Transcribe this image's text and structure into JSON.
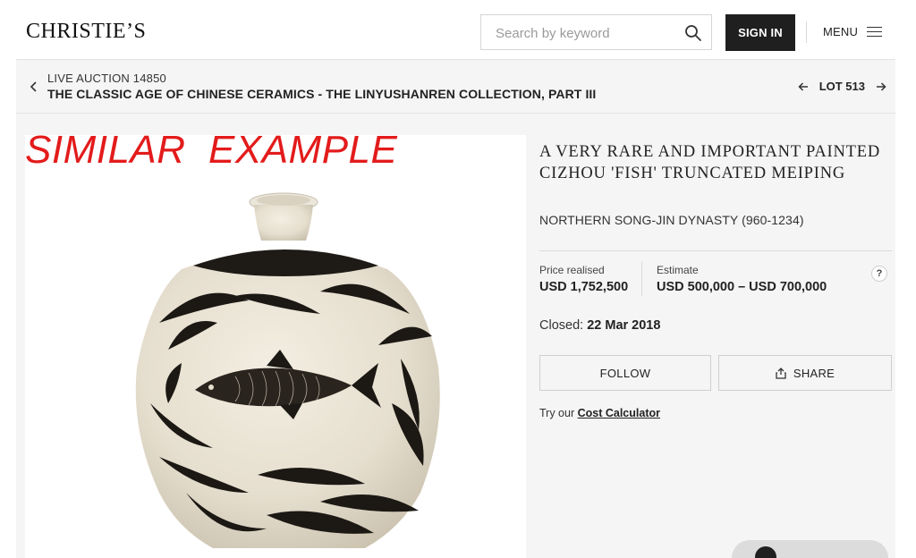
{
  "header": {
    "logo": "CHRISTIE’S",
    "search_placeholder": "Search by keyword",
    "signin_label": "SIGN IN",
    "menu_label": "MENU"
  },
  "sale": {
    "auction_id": "LIVE AUCTION 14850",
    "auction_title": "THE CLASSIC AGE OF CHINESE CERAMICS - THE LINYUSHANREN COLLECTION, PART III",
    "lot_label": "LOT 513"
  },
  "image": {
    "overlay_text": "SIMILAR  EXAMPLE",
    "overlay_color": "#e31b1b"
  },
  "lot": {
    "title": "A VERY RARE AND IMPORTANT PAINTED CIZHOU 'FISH' TRUNCATED MEIPING",
    "subtitle": "NORTHERN SONG-JIN DYNASTY (960-1234)",
    "price_label": "Price realised",
    "price_value": "USD 1,752,500",
    "estimate_label": "Estimate",
    "estimate_value": "USD 500,000 – USD 700,000",
    "help_label": "?",
    "closed_label": "Closed:",
    "closed_date": "22 Mar 2018",
    "follow_label": "FOLLOW",
    "share_label": "SHARE",
    "calc_prefix": "Try our",
    "calc_link": "Cost Calculator"
  }
}
